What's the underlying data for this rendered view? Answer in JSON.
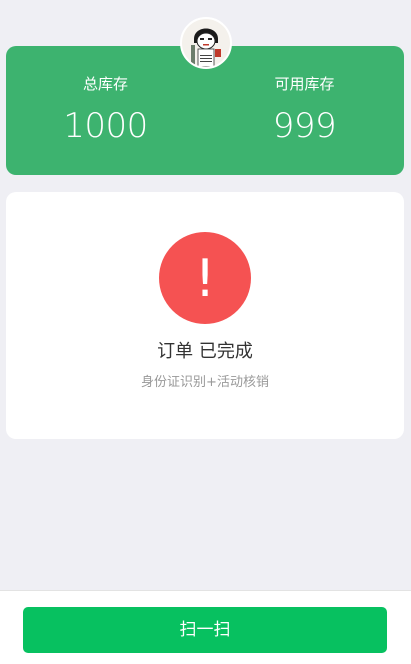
{
  "theme": {
    "stock_card_color": "#3db36f",
    "alert_color": "#f55252",
    "primary_button_color": "#07c160",
    "page_background": "#efeff4"
  },
  "user": {
    "avatar_icon": "user-avatar-cartoon"
  },
  "stock": {
    "total_label": "总库存",
    "total_value": "1000",
    "available_label": "可用库存",
    "available_value": "999"
  },
  "status": {
    "icon": "exclamation-icon",
    "icon_glyph": "!",
    "title": "订单 已完成",
    "subtitle": "身份证识别+活动核销"
  },
  "footer": {
    "scan_button_label": "扫一扫"
  }
}
